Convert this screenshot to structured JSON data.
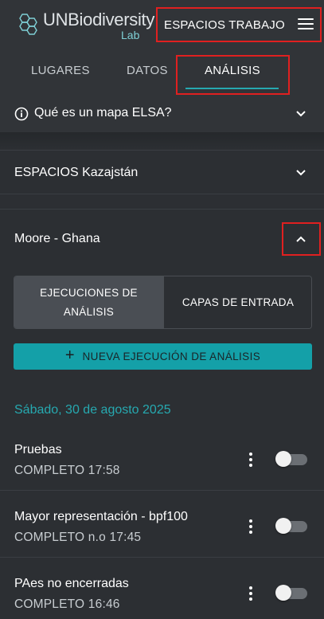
{
  "header": {
    "logo_name": "UNBiodiversity",
    "logo_sub": "Lab",
    "workspace_label": "ESPACIOS TRABAJO",
    "menu_icon": "hamburger-menu-icon"
  },
  "tabs": [
    {
      "label": "LUGARES",
      "active": false
    },
    {
      "label": "DATOS",
      "active": false
    },
    {
      "label": "ANÁLISIS",
      "active": true
    }
  ],
  "info_section": {
    "icon": "info-icon",
    "label": "Qué es un mapa ELSA?"
  },
  "workspace_section": {
    "label": "ESPACIOS Kazajstán"
  },
  "project": {
    "title": "Moore - Ghana",
    "segments": {
      "left": "EJECUCIONES DE ANÁLISIS",
      "right": "CAPAS DE ENTRADA"
    },
    "new_run_button": "NUEVA EJECUCIÓN DE ANÁLISIS",
    "date_heading": "Sábado, 30 de agosto 2025",
    "runs": [
      {
        "name": "Pruebas",
        "status": "COMPLETO 17:58",
        "toggle_on": false
      },
      {
        "name": "Mayor representación - bpf100",
        "status": "COMPLETO n.o 17:45",
        "toggle_on": false
      },
      {
        "name": "PAes no encerradas",
        "status": "COMPLETO 16:46",
        "toggle_on": false
      }
    ]
  },
  "colors": {
    "accent": "#26a9b0",
    "button": "#14a0a8",
    "highlight": "#e02020",
    "background": "#2c2f33"
  }
}
